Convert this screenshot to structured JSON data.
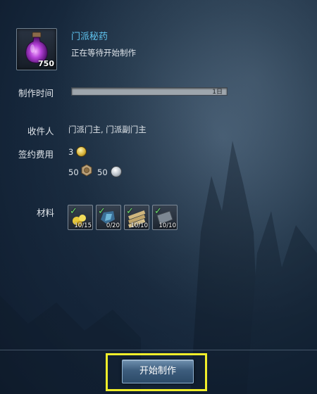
{
  "item": {
    "name": "门派秘药",
    "status": "正在等待开始制作",
    "count": "750",
    "icon": "purple-potion-icon"
  },
  "crafting_time": {
    "label": "制作时间",
    "value": "1日",
    "progress": 0
  },
  "recipient": {
    "label": "收件人",
    "value": "门派门主, 门派副门主"
  },
  "contract_fee": {
    "label": "签约费用",
    "gold": "3",
    "bronze": "50",
    "silver": "50"
  },
  "materials": {
    "label": "材料",
    "items": [
      {
        "count": "10/15",
        "icon": "gold-flower-icon",
        "ready": true
      },
      {
        "count": "0/20",
        "icon": "blue-crystal-icon",
        "ready": true
      },
      {
        "count": "10/10",
        "icon": "wood-planks-icon",
        "ready": true
      },
      {
        "count": "10/10",
        "icon": "iron-plate-icon",
        "ready": true
      }
    ]
  },
  "actions": {
    "start_label": "开始制作"
  },
  "colors": {
    "title": "#5fc3ee",
    "highlight": "#f0ee2a",
    "check": "#6be06b"
  }
}
